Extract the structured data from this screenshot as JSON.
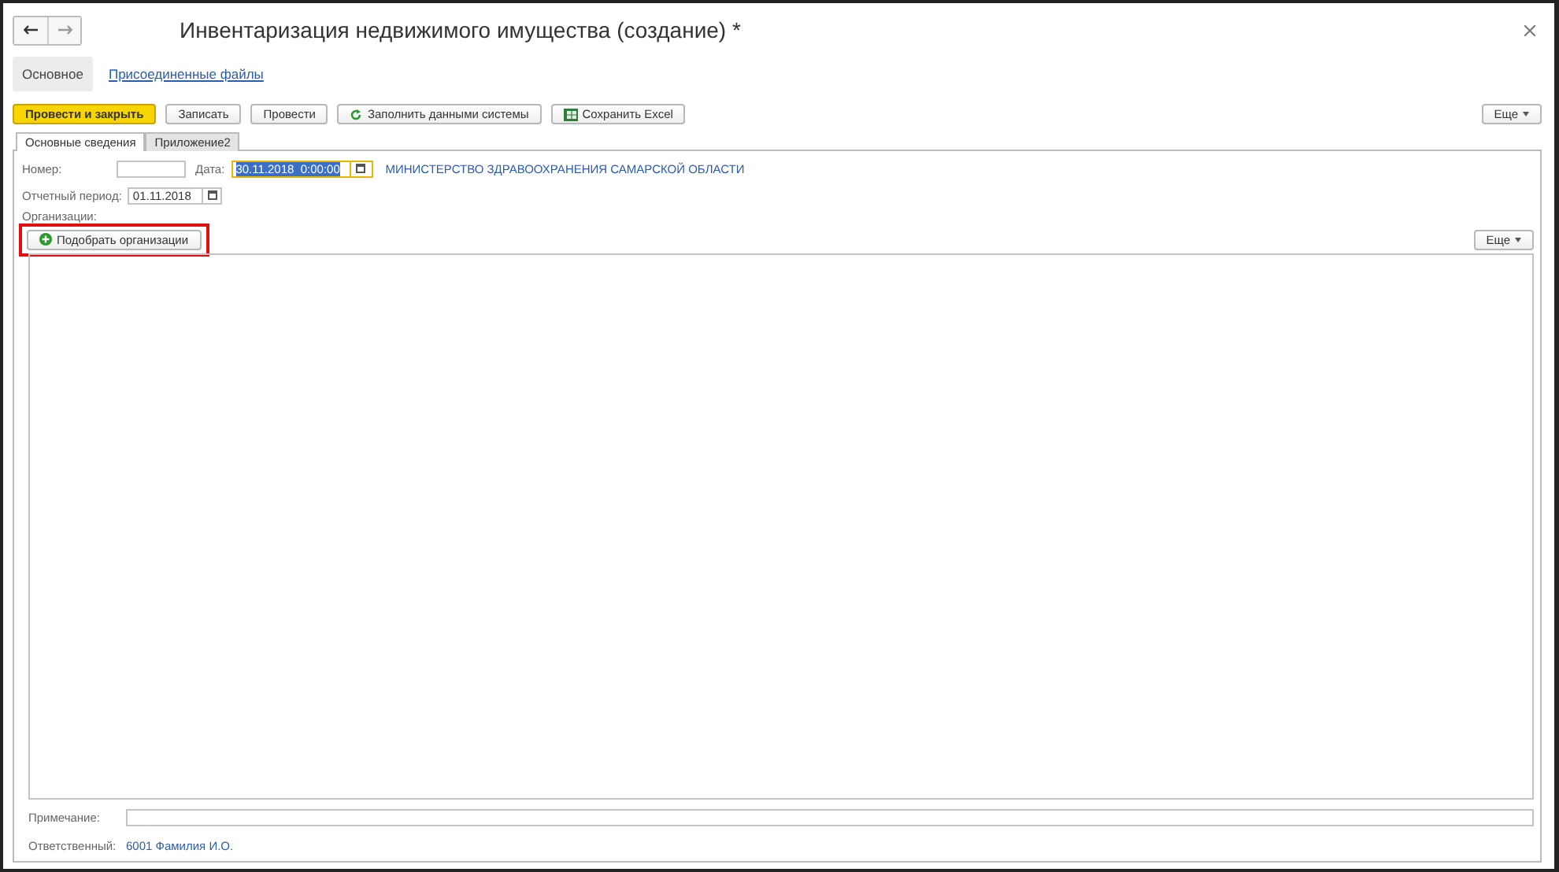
{
  "window": {
    "title": "Инвентаризация недвижимого имущества (создание) *"
  },
  "nav_tabs": [
    {
      "label": "Основное",
      "selected": true
    },
    {
      "label": "Присоединенные файлы",
      "selected": false
    }
  ],
  "toolbar": {
    "buttons": [
      {
        "label": "Провести и закрыть",
        "kind": "primary"
      },
      {
        "label": "Записать",
        "kind": "plain"
      },
      {
        "label": "Провести",
        "kind": "plain"
      },
      {
        "label": "Заполнить данными системы",
        "kind": "refresh"
      },
      {
        "label": "Сохранить Excel",
        "kind": "excel"
      }
    ],
    "more": "Еще"
  },
  "tabs": [
    {
      "label": "Основные сведения",
      "selected": true
    },
    {
      "label": "Приложение2",
      "selected": false
    }
  ],
  "number": {
    "label": "Номер:"
  },
  "date": {
    "label": "Дата:",
    "value": "30.11.2018  0:00:00",
    "focused": true
  },
  "organization_link": "МИНИСТЕРСТВО ЗДРАВООХРАНЕНИЯ САМАРСКОЙ ОБЛАСТИ",
  "period": {
    "label": "Отчетный период:",
    "value": "01.11.2018"
  },
  "organizations": {
    "label": "Организации:",
    "add_button": "Подобрать организации",
    "highlighted": true,
    "more": "Еще"
  },
  "note": {
    "label": "Примечание:"
  },
  "responsible": {
    "label": "Ответственный:",
    "value": "6001 Фамилия И.О."
  }
}
